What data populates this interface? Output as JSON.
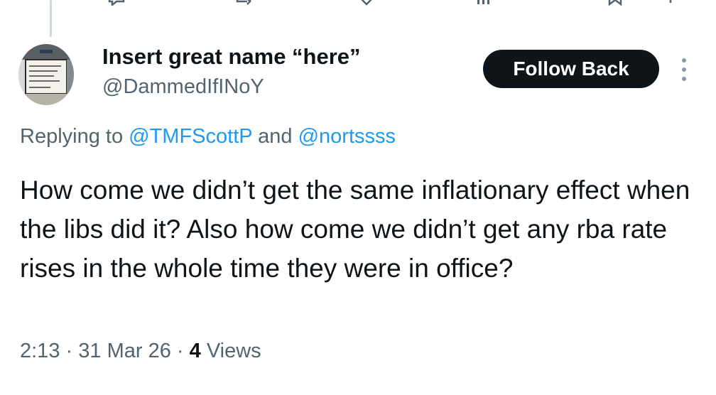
{
  "tweet": {
    "author_name": "Insert great name “here”",
    "author_handle": "@DammedIfINoY",
    "follow_button": "Follow Back",
    "replying_to_prefix": "Replying to",
    "replying_to_users": [
      "@TMFScottP",
      "@nortssss"
    ],
    "replying_to_joiner": "and",
    "text": "How come we didn’t get the same inflationary effect when the libs did it? Also how come we didn’t get any rba rate rises in the whole time they were in office?",
    "time": "2:13",
    "date": "31 Mar 26",
    "views_count": "4",
    "views_label": "Views",
    "separator": "·"
  },
  "colors": {
    "text_primary": "#0f1419",
    "text_secondary": "#536471",
    "link": "#1d9bf0",
    "button_bg": "#0f1419",
    "button_text": "#ffffff"
  },
  "icons": {
    "top_bar": [
      "reply-icon",
      "retweet-icon",
      "like-icon",
      "views-icon",
      "bookmark-icon",
      "share-icon"
    ],
    "more": "more-vertical-icon"
  }
}
